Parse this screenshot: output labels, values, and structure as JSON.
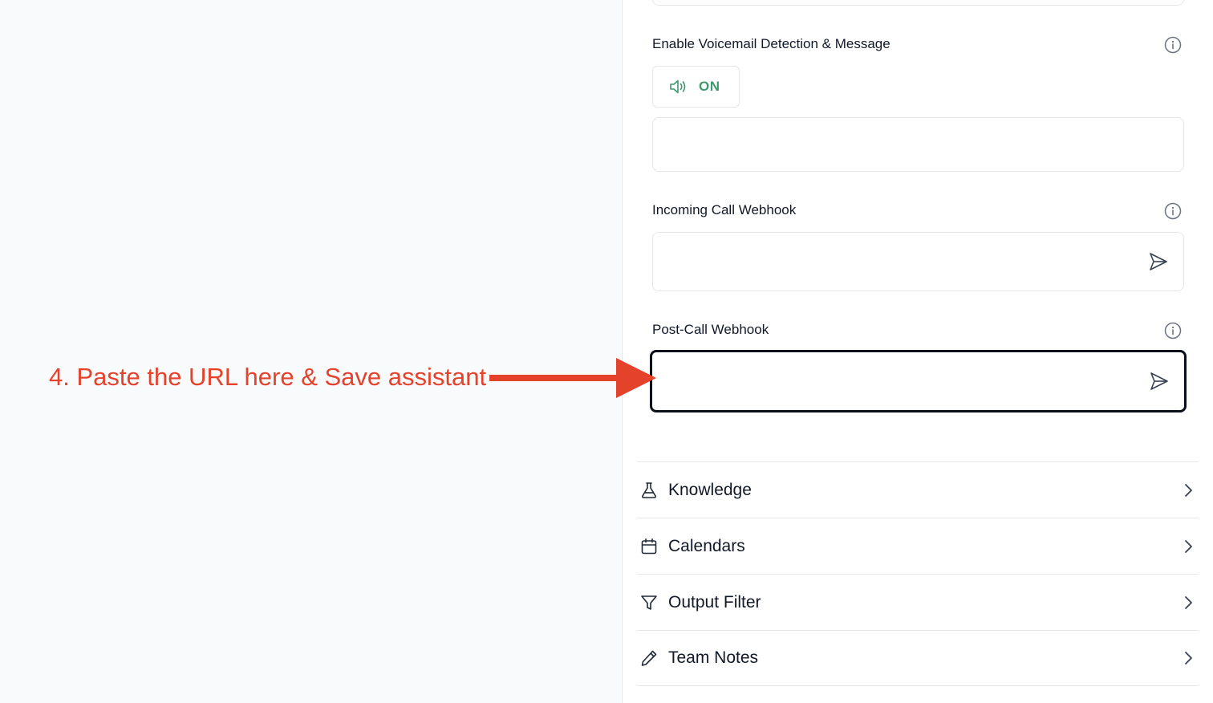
{
  "voicemail": {
    "label": "Enable Voicemail Detection & Message",
    "toggle_state": "ON",
    "message_value": ""
  },
  "incoming_webhook": {
    "label": "Incoming Call Webhook",
    "value": ""
  },
  "post_call_webhook": {
    "label": "Post-Call Webhook",
    "value": ""
  },
  "sections": [
    {
      "label": "Knowledge",
      "icon": "flask-icon"
    },
    {
      "label": "Calendars",
      "icon": "calendar-icon"
    },
    {
      "label": "Output Filter",
      "icon": "filter-icon"
    },
    {
      "label": "Team Notes",
      "icon": "pencil-icon"
    }
  ],
  "annotation": {
    "text": "4. Paste the URL here & Save assistant",
    "color": "#e5422b"
  },
  "colors": {
    "on_green": "#3f9a6e",
    "active_border": "#0b0f1a"
  }
}
